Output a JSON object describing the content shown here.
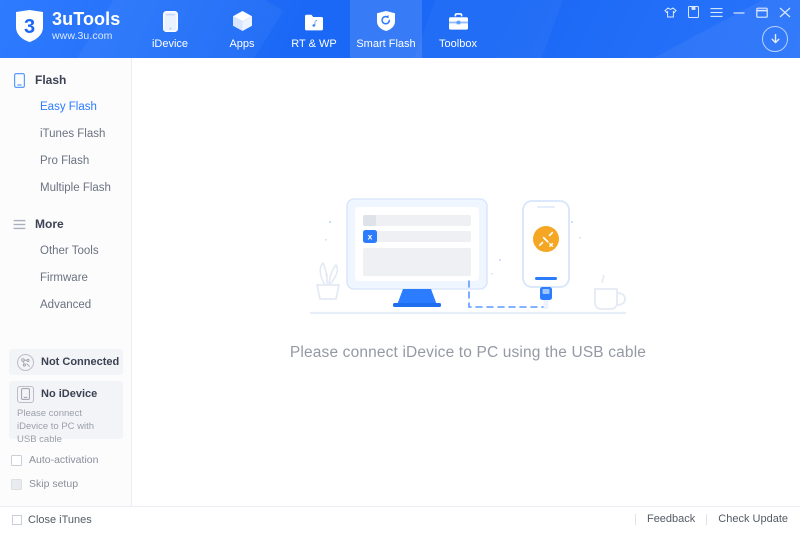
{
  "app": {
    "logo_name": "3uTools",
    "logo_url": "www.3u.com",
    "logo_icon": "shield-3-logo"
  },
  "titlebar": {
    "buttons": [
      {
        "name": "skin-icon",
        "label": "Skin"
      },
      {
        "name": "notes-icon",
        "label": "Notes"
      },
      {
        "name": "menu-icon",
        "label": "Menu"
      },
      {
        "name": "minimize-icon",
        "label": "Minimize"
      },
      {
        "name": "maximize-icon",
        "label": "Maximize"
      },
      {
        "name": "close-icon",
        "label": "Close"
      }
    ],
    "download_icon": "download-arrow-icon"
  },
  "nav": {
    "items": [
      {
        "label": "iDevice",
        "icon": "phone-icon",
        "active": false
      },
      {
        "label": "Apps",
        "icon": "cube-icon",
        "active": false
      },
      {
        "label": "RT & WP",
        "icon": "folder-music-icon",
        "active": false
      },
      {
        "label": "Smart Flash",
        "icon": "shield-refresh-icon",
        "active": true
      },
      {
        "label": "Toolbox",
        "icon": "briefcase-icon",
        "active": false
      }
    ]
  },
  "sidebar": {
    "groups": [
      {
        "label": "Flash",
        "icon": "phone-outline-icon",
        "items": [
          {
            "label": "Easy Flash",
            "active": true
          },
          {
            "label": "iTunes Flash",
            "active": false
          },
          {
            "label": "Pro Flash",
            "active": false
          },
          {
            "label": "Multiple Flash",
            "active": false
          }
        ]
      },
      {
        "label": "More",
        "icon": "list-lines-icon",
        "items": [
          {
            "label": "Other Tools",
            "active": false
          },
          {
            "label": "Firmware",
            "active": false
          },
          {
            "label": "Advanced",
            "active": false
          }
        ]
      }
    ],
    "status_panels": [
      {
        "title": "Not Connected",
        "icon": "network-disconnected-icon",
        "sub": ""
      },
      {
        "title": "No iDevice",
        "icon": "device-outline-icon",
        "sub": "Please connect iDevice to PC with USB cable"
      }
    ],
    "options": [
      {
        "label": "Auto-activation",
        "checked": false,
        "disabled": false
      },
      {
        "label": "Skip setup",
        "checked": false,
        "disabled": true
      }
    ]
  },
  "main": {
    "illustration": "pc-phone-usb-disconnected-illustration",
    "hint": "Please connect iDevice to PC using the USB cable"
  },
  "footer": {
    "close_itunes_label": "Close iTunes",
    "close_itunes_checked": false,
    "feedback_label": "Feedback",
    "check_update_label": "Check Update"
  },
  "colors": {
    "header_blue": "#1a68f5",
    "accent_blue": "#2b7cff",
    "warn_orange": "#f5a623",
    "muted_text": "#9499a4"
  }
}
